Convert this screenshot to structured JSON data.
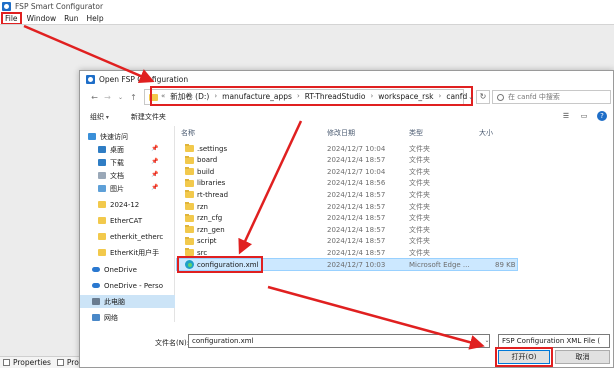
{
  "app": {
    "title": "FSP Smart Configurator",
    "menu": [
      "File",
      "Window",
      "Run",
      "Help"
    ],
    "bottom_tabs": [
      "Properties",
      "Prob"
    ]
  },
  "dialog": {
    "title": "Open FSP Configuration",
    "breadcrumb": [
      "新加卷 (D:)",
      "manufacture_apps",
      "RT-ThreadStudio",
      "workspace_rsk",
      "canfd"
    ],
    "search_placeholder": "在 canfd 中搜索",
    "commands": {
      "organize": "组织",
      "new_folder": "新建文件夹"
    },
    "nav": {
      "quick_access": "快速访问",
      "items": [
        "桌面",
        "下载",
        "文档",
        "图片",
        "2024-12",
        "EtherCAT",
        "etherkit_etherc",
        "EtherKit用户手"
      ],
      "onedrive": "OneDrive",
      "onedrive_personal": "OneDrive - Perso",
      "this_pc": "此电脑",
      "network": "网络"
    },
    "columns": {
      "name": "名称",
      "date": "修改日期",
      "type": "类型",
      "size": "大小"
    },
    "files": [
      {
        "name": ".settings",
        "date": "2024/12/7 10:04",
        "type": "文件夹",
        "size": ""
      },
      {
        "name": "board",
        "date": "2024/12/4 18:57",
        "type": "文件夹",
        "size": ""
      },
      {
        "name": "build",
        "date": "2024/12/7 10:04",
        "type": "文件夹",
        "size": ""
      },
      {
        "name": "libraries",
        "date": "2024/12/4 18:56",
        "type": "文件夹",
        "size": ""
      },
      {
        "name": "rt-thread",
        "date": "2024/12/4 18:57",
        "type": "文件夹",
        "size": ""
      },
      {
        "name": "rzn",
        "date": "2024/12/4 18:57",
        "type": "文件夹",
        "size": ""
      },
      {
        "name": "rzn_cfg",
        "date": "2024/12/4 18:57",
        "type": "文件夹",
        "size": ""
      },
      {
        "name": "rzn_gen",
        "date": "2024/12/4 18:57",
        "type": "文件夹",
        "size": ""
      },
      {
        "name": "script",
        "date": "2024/12/4 18:57",
        "type": "文件夹",
        "size": ""
      },
      {
        "name": "src",
        "date": "2024/12/4 18:57",
        "type": "文件夹",
        "size": ""
      },
      {
        "name": "configuration.xml",
        "date": "2024/12/7 10:03",
        "type": "Microsoft Edge ...",
        "size": "89 KB"
      }
    ],
    "filename_label": "文件名(N):",
    "filename_value": "configuration.xml",
    "filetype": "FSP Configuration XML File (",
    "open_button": "打开(O)",
    "cancel_button": "取消"
  }
}
